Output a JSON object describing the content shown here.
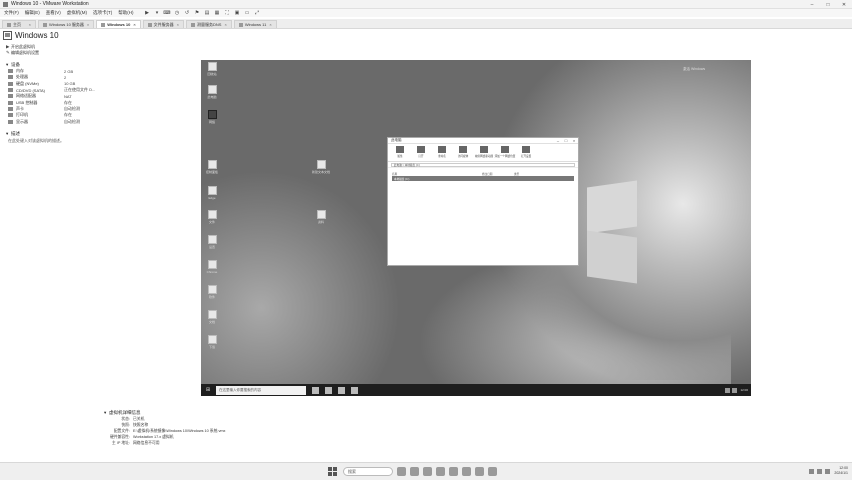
{
  "window": {
    "title": "Windows 10 - VMware Workstation"
  },
  "menu": [
    "文件(F)",
    "编辑(E)",
    "查看(V)",
    "虚拟机(M)",
    "选项卡(T)",
    "帮助(H)"
  ],
  "tabs": [
    {
      "label": "主页",
      "active": false
    },
    {
      "label": "Windows 10 服务器",
      "active": false
    },
    {
      "label": "Windows 10",
      "active": true
    },
    {
      "label": "文件服务器",
      "active": false
    },
    {
      "label": "测量服务DNS",
      "active": false
    },
    {
      "label": "Windows 11",
      "active": false
    }
  ],
  "vm": {
    "name": "Windows 10"
  },
  "actions": [
    {
      "glyph": "▶",
      "label": "开启此虚拟机"
    },
    {
      "glyph": "✎",
      "label": "编辑虚拟机设置"
    }
  ],
  "devices_section": {
    "title": "设备"
  },
  "devices": [
    {
      "name": "内存",
      "value": "2 GB"
    },
    {
      "name": "处理器",
      "value": "2"
    },
    {
      "name": "硬盘 (NVMe)",
      "value": "10 GB"
    },
    {
      "name": "CD/DVD (SATA)",
      "value": "正在使用文件 D..."
    },
    {
      "name": "网络适配器",
      "value": "NAT"
    },
    {
      "name": "USB 控制器",
      "value": "存在"
    },
    {
      "name": "声卡",
      "value": "自动检测"
    },
    {
      "name": "打印机",
      "value": "存在"
    },
    {
      "name": "显示器",
      "value": "自动检测"
    }
  ],
  "description_section": {
    "title": "描述",
    "text": "在此处键入对该虚拟机的描述。"
  },
  "guest": {
    "notification": "激活 Windows",
    "explorer": {
      "title": "此电脑",
      "ribbon": [
        "属性",
        "打开",
        "重命名",
        "访问媒体",
        "映射网络驱动器",
        "添加一个网络位置",
        "打开设置"
      ],
      "address": "此电脑 > 本地磁盘 (C:)",
      "columns": [
        "名称",
        "修改日期",
        "类型"
      ],
      "row": {
        "name": "本地磁盘 (C:)",
        "date": "",
        "type": ""
      }
    },
    "taskbar": {
      "search_placeholder": "在这里输入你要搜索的内容",
      "clock": "12:00"
    },
    "desktop_icons": [
      "回收站",
      "此电脑",
      "网络",
      "控制面板",
      "Edge",
      "文件",
      "设置",
      "Chrome",
      "软件",
      "文档",
      "下载"
    ],
    "center_icons": [
      "新建文本文档",
      "资料"
    ]
  },
  "vm_details": {
    "title": "虚拟机详细信息",
    "rows": [
      {
        "key": "状态:",
        "value": "已关机"
      },
      {
        "key": "快照:",
        "value": "快照名称"
      },
      {
        "key": "配置文件:",
        "value": "E:\\虚拟机\\系统镜像\\Windows 10\\Windows 10 系统.vmx"
      },
      {
        "key": "硬件兼容性:",
        "value": "Workstation 17.x 虚拟机"
      },
      {
        "key": "主 IP 地址:",
        "value": "网络信息不可用"
      }
    ]
  },
  "host_taskbar": {
    "search_placeholder": "搜索",
    "time": "12:00",
    "date": "2024/1/1"
  }
}
